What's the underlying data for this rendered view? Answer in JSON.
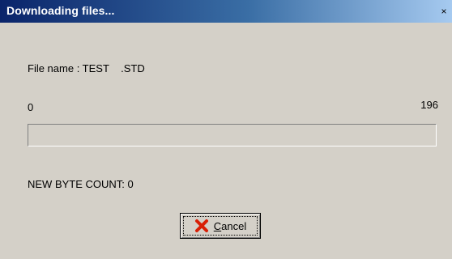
{
  "window": {
    "title": "Downloading files...",
    "close_glyph": "×"
  },
  "file": {
    "label": "File name : TEST    .STD"
  },
  "progress": {
    "min_label": "0",
    "max_label": "196",
    "value": 0,
    "max": 196
  },
  "status": {
    "byte_count": "NEW BYTE COUNT: 0"
  },
  "cancel_button": {
    "mnemonic": "C",
    "rest": "ancel",
    "icon": "red-x-icon"
  },
  "colors": {
    "titlebar_start": "#0a246a",
    "titlebar_end": "#a6caf0",
    "face": "#d4d0c8",
    "cancel_icon": "#d81e05"
  }
}
